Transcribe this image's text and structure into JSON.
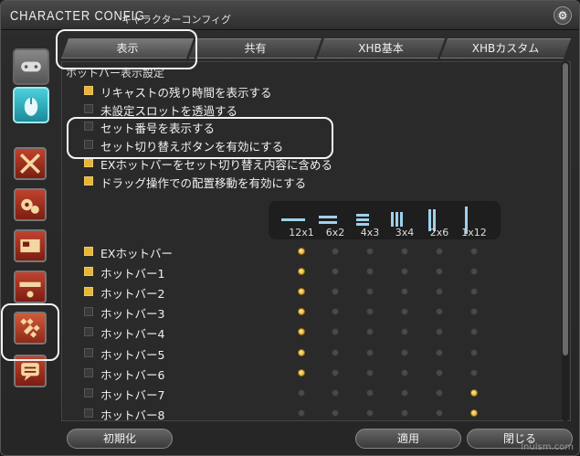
{
  "window": {
    "title": "CHARACTER CONFIG",
    "subtitle": "キャラクターコンフィグ"
  },
  "tabs": [
    {
      "label": "表示",
      "active": true
    },
    {
      "label": "共有",
      "active": false
    },
    {
      "label": "XHB基本",
      "active": false
    },
    {
      "label": "XHBカスタム",
      "active": false
    }
  ],
  "section": {
    "header": "ホットバー表示設定",
    "options": [
      {
        "label": "リキャストの残り時間を表示する",
        "checked": true
      },
      {
        "label": "未設定スロットを透過する",
        "checked": false
      },
      {
        "label": "セット番号を表示する",
        "checked": false
      },
      {
        "label": "セット切り替えボタンを有効にする",
        "checked": false
      },
      {
        "label": "EXホットバーをセット切り替え内容に含める",
        "checked": true
      },
      {
        "label": "ドラッグ操作での配置移動を有効にする",
        "checked": true
      }
    ]
  },
  "layouts": [
    "12x1",
    "6x2",
    "4x3",
    "3x4",
    "2x6",
    "1x12"
  ],
  "hotbars": [
    {
      "label": "EXホットバー",
      "checked": true,
      "layout": 0
    },
    {
      "label": "ホットバー1",
      "checked": true,
      "layout": 0
    },
    {
      "label": "ホットバー2",
      "checked": true,
      "layout": 0
    },
    {
      "label": "ホットバー3",
      "checked": false,
      "layout": 0
    },
    {
      "label": "ホットバー4",
      "checked": false,
      "layout": 0
    },
    {
      "label": "ホットバー5",
      "checked": false,
      "layout": 0
    },
    {
      "label": "ホットバー6",
      "checked": false,
      "layout": 0
    },
    {
      "label": "ホットバー7",
      "checked": false,
      "layout": 5
    },
    {
      "label": "ホットバー8",
      "checked": false,
      "layout": 5
    }
  ],
  "footer": {
    "reset_label": "初期化",
    "apply_label": "適用",
    "close_label": "閉じる"
  },
  "watermark": "lnulsm.com",
  "colors": {
    "accent": "#e6b53a",
    "highlight": "#f4f4f4"
  }
}
